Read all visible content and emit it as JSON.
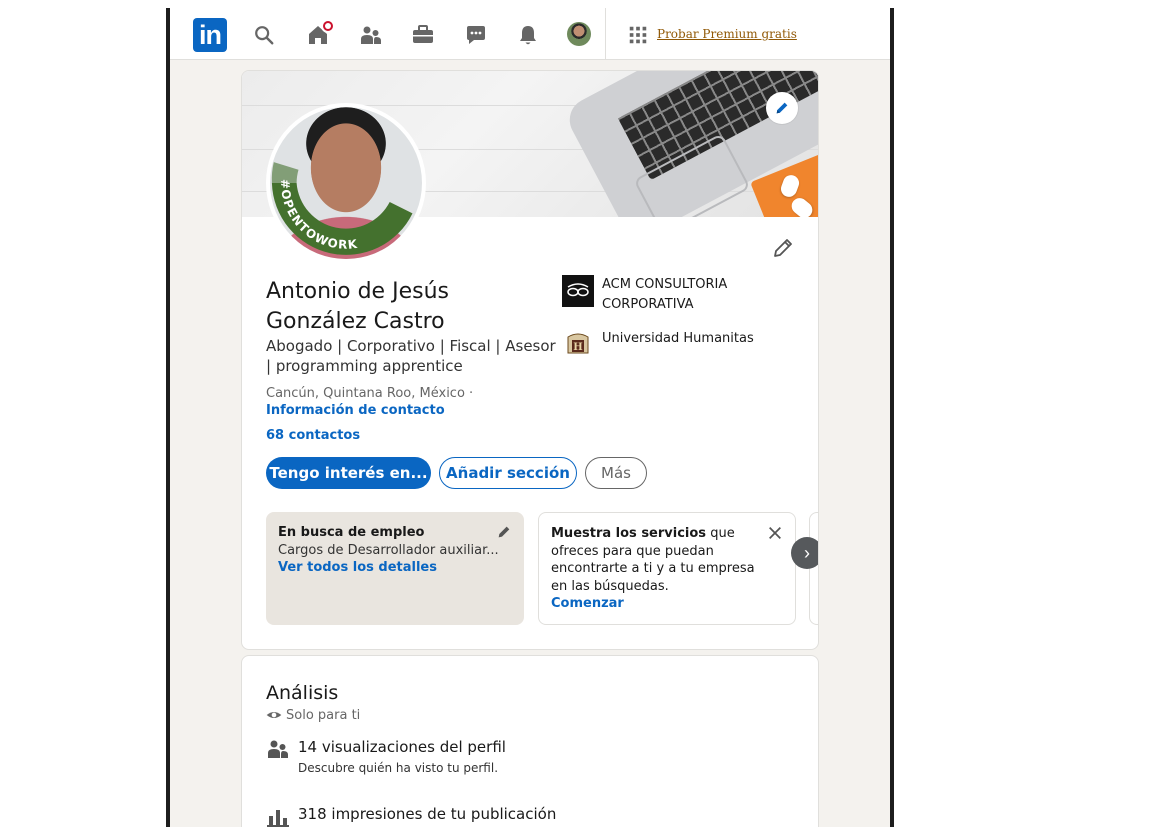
{
  "nav": {
    "logo_text": "in",
    "premium_label": "Probar Premium gratis"
  },
  "profile": {
    "name": "Antonio de Jesús González Castro",
    "headline": "Abogado | Corporativo | Fiscal | Asesor | programming apprentice",
    "location": "Cancún, Quintana Roo, México ·",
    "contact_link": "Información de contacto",
    "connections": "68 contactos",
    "open_to_work_text": "#OPENTOWORK",
    "organizations": [
      {
        "name": "ACM CONSULTORIA CORPORATIVA"
      },
      {
        "name": "Universidad Humanitas"
      }
    ],
    "buttons": {
      "primary": "Tengo interés en...",
      "secondary": "Añadir sección",
      "tertiary": "Más"
    }
  },
  "tiles": {
    "open_to_work": {
      "title": "En busca de empleo",
      "detail": "Cargos de Desarrollador auxiliar...",
      "link": "Ver todos los detalles"
    },
    "services": {
      "title": "Muestra los servicios",
      "text": "que ofreces para que puedan encontrarte a ti y a tu empresa en las búsquedas.",
      "link": "Comenzar"
    },
    "next_label": "›"
  },
  "analytics": {
    "title": "Análisis",
    "private_label": "Solo para ti",
    "items": [
      {
        "head": "14 visualizaciones del perfil",
        "sub": "Descubre quién ha visto tu perfil."
      },
      {
        "head": "318 impresiones de tu publicación",
        "sub": ""
      }
    ]
  },
  "colors": {
    "brand_blue": "#0a66c2",
    "open_to_work_green": "#44712e",
    "premium_gold": "#915907",
    "notification_red": "#cb112d"
  },
  "icons": [
    "linkedin-logo",
    "search-icon",
    "home-icon",
    "network-icon",
    "jobs-icon",
    "messaging-icon",
    "bell-icon",
    "grid-icon",
    "pencil-icon",
    "close-icon",
    "eye-icon",
    "people-icon",
    "bar-chart-icon"
  ]
}
